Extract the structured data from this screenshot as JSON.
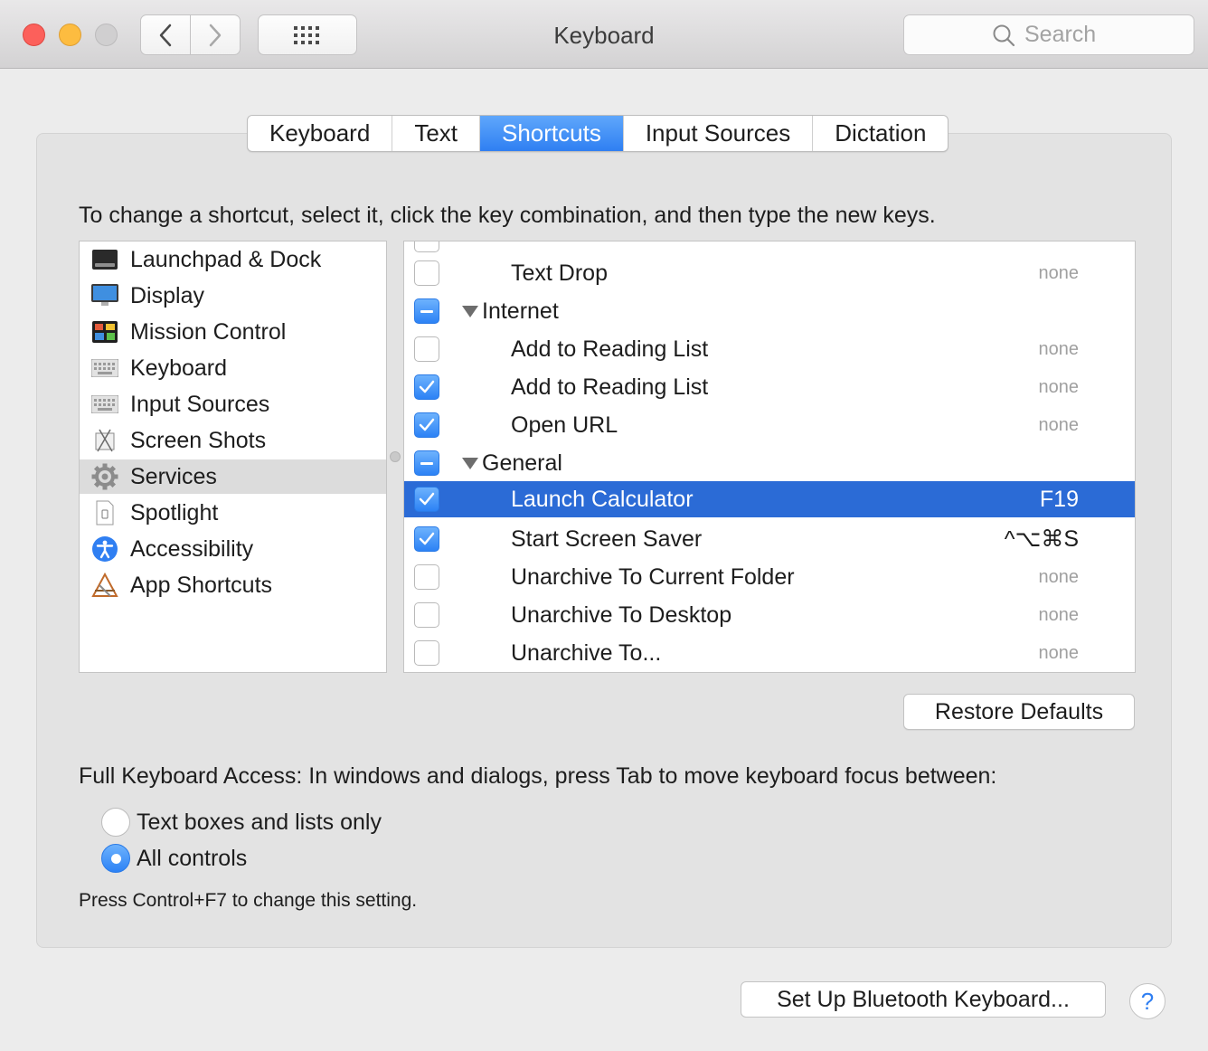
{
  "window": {
    "title": "Keyboard"
  },
  "toolbar": {
    "search_placeholder": "Search"
  },
  "tabs": [
    {
      "label": "Keyboard",
      "active": false
    },
    {
      "label": "Text",
      "active": false
    },
    {
      "label": "Shortcuts",
      "active": true
    },
    {
      "label": "Input Sources",
      "active": false
    },
    {
      "label": "Dictation",
      "active": false
    }
  ],
  "instruction": "To change a shortcut, select it, click the key combination, and then type the new keys.",
  "categories": [
    {
      "label": "Launchpad & Dock",
      "icon": "launchpad-dock-icon"
    },
    {
      "label": "Display",
      "icon": "display-icon"
    },
    {
      "label": "Mission Control",
      "icon": "mission-control-icon"
    },
    {
      "label": "Keyboard",
      "icon": "keyboard-icon"
    },
    {
      "label": "Input Sources",
      "icon": "input-sources-icon"
    },
    {
      "label": "Screen Shots",
      "icon": "screen-shots-icon"
    },
    {
      "label": "Services",
      "icon": "gear-icon",
      "selected": true
    },
    {
      "label": "Spotlight",
      "icon": "spotlight-icon"
    },
    {
      "label": "Accessibility",
      "icon": "accessibility-icon"
    },
    {
      "label": "App Shortcuts",
      "icon": "app-shortcuts-icon"
    }
  ],
  "shortcuts": [
    {
      "label": "Text Drop",
      "keys": "none",
      "state": "off",
      "type": "item"
    },
    {
      "label": "Internet",
      "state": "mixed",
      "type": "group"
    },
    {
      "label": "Add to Reading List",
      "keys": "none",
      "state": "off",
      "type": "item"
    },
    {
      "label": "Add to Reading List",
      "keys": "none",
      "state": "on",
      "type": "item"
    },
    {
      "label": "Open URL",
      "keys": "none",
      "state": "on",
      "type": "item"
    },
    {
      "label": "General",
      "state": "mixed",
      "type": "group"
    },
    {
      "label": "Launch Calculator",
      "keys": "F19",
      "state": "on",
      "type": "item",
      "selected": true
    },
    {
      "label": "Start Screen Saver",
      "keys": "^⌥⌘S",
      "state": "on",
      "type": "item"
    },
    {
      "label": "Unarchive To Current Folder",
      "keys": "none",
      "state": "off",
      "type": "item"
    },
    {
      "label": "Unarchive To Desktop",
      "keys": "none",
      "state": "off",
      "type": "item"
    },
    {
      "label": "Unarchive To...",
      "keys": "none",
      "state": "off",
      "type": "item"
    }
  ],
  "restore_defaults": "Restore Defaults",
  "full_keyboard_access": {
    "label": "Full Keyboard Access: In windows and dialogs, press Tab to move keyboard focus between:",
    "options": [
      {
        "label": "Text boxes and lists only",
        "selected": false
      },
      {
        "label": "All controls",
        "selected": true
      }
    ],
    "hint": "Press Control+F7 to change this setting."
  },
  "bluetooth_button": "Set Up Bluetooth Keyboard...",
  "help_label": "?",
  "colors": {
    "accent": "#2f7ff2",
    "selection": "#2b6bd6"
  }
}
